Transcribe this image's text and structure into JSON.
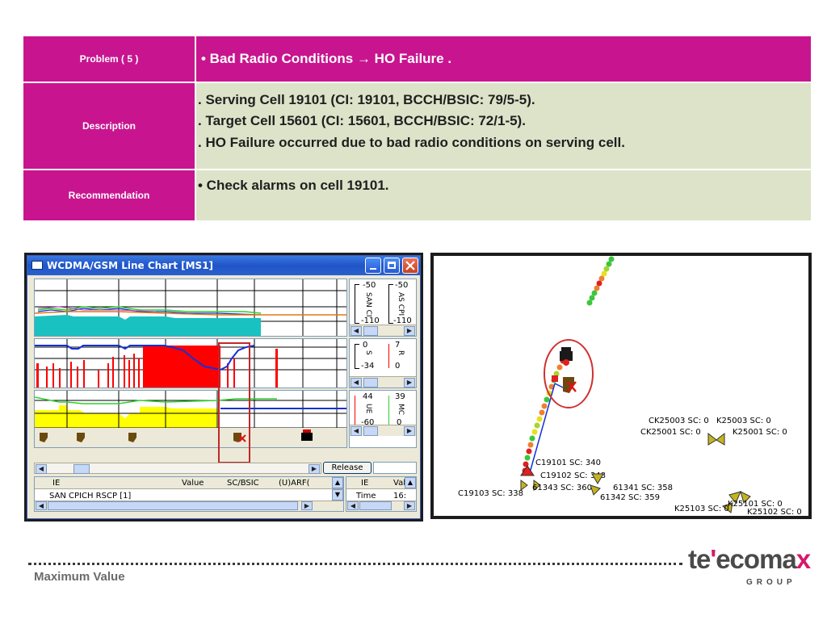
{
  "table": {
    "problem_label": "Problem ( 5 )",
    "problem_value": "• Bad Radio Conditions → HO Failure .",
    "description_label": "Description",
    "description_lines": [
      ". Serving Cell 19101 (CI: 19101, BCCH/BSIC: 79/5-5).",
      ". Target Cell 15601 (CI: 15601, BCCH/BSIC: 72/1-5).",
      ". HO Failure occurred due to bad radio conditions on serving cell."
    ],
    "recommendation_label": "Recommendation",
    "recommendation_value": "• Check alarms on cell 19101."
  },
  "chart_window": {
    "title": "WCDMA/GSM Line Chart [MS1]",
    "panel1": {
      "left_top": "-50",
      "left_label": "SAN CI",
      "left_bottom": "-110",
      "right_top": "-50",
      "right_label": "AS CPI",
      "right_bottom": "-110"
    },
    "panel2": {
      "left_top": "0",
      "left_label": "S",
      "left_bottom": "-34",
      "right_top": "7",
      "right_label": "R",
      "right_bottom": "0"
    },
    "panel3": {
      "left_top": "44",
      "left_label": "UE",
      "left_bottom": "-60",
      "right_top": "39",
      "right_label": "MC",
      "right_bottom": "0"
    },
    "release_label": "Release",
    "ie_table": {
      "headers": [
        "IE",
        "Value",
        "SC/BSIC",
        "(U)ARF("
      ],
      "row": "SAN CPICH RSCP [1]"
    },
    "ie_table2": {
      "headers": [
        "IE",
        "Val"
      ],
      "row_ie": "Time",
      "row_val": "16:"
    },
    "colors": {
      "yellow": "#ffff00",
      "cyan": "#19c1c1",
      "red": "#ff0000",
      "blue": "#1530d8",
      "green": "#2fd02f"
    }
  },
  "map": {
    "labels": {
      "ck25003": "CK25003  SC: 0",
      "k25003": "K25003   SC: 0",
      "ck25001": "CK25001  SC: 0",
      "k25001": "K25001  SC: 0",
      "c19101": "C19101 SC: 340",
      "c19102": "C19102 SC: 348",
      "c19103": "C19103 SC: 338",
      "s61343": "61343 SC: 360",
      "s61341": "61341 SC: 358",
      "s61342": "61342 SC: 359",
      "k25103": "K25103  SC: 0",
      "k25101": "K25101  SC: 0",
      "k25102": "K25102  SC: 0"
    }
  },
  "footer": {
    "text": "Maximum Value",
    "logo_main": "te",
    "logo_mid": "ecoma",
    "logo_x": "x",
    "logo_group": "GROUP"
  }
}
